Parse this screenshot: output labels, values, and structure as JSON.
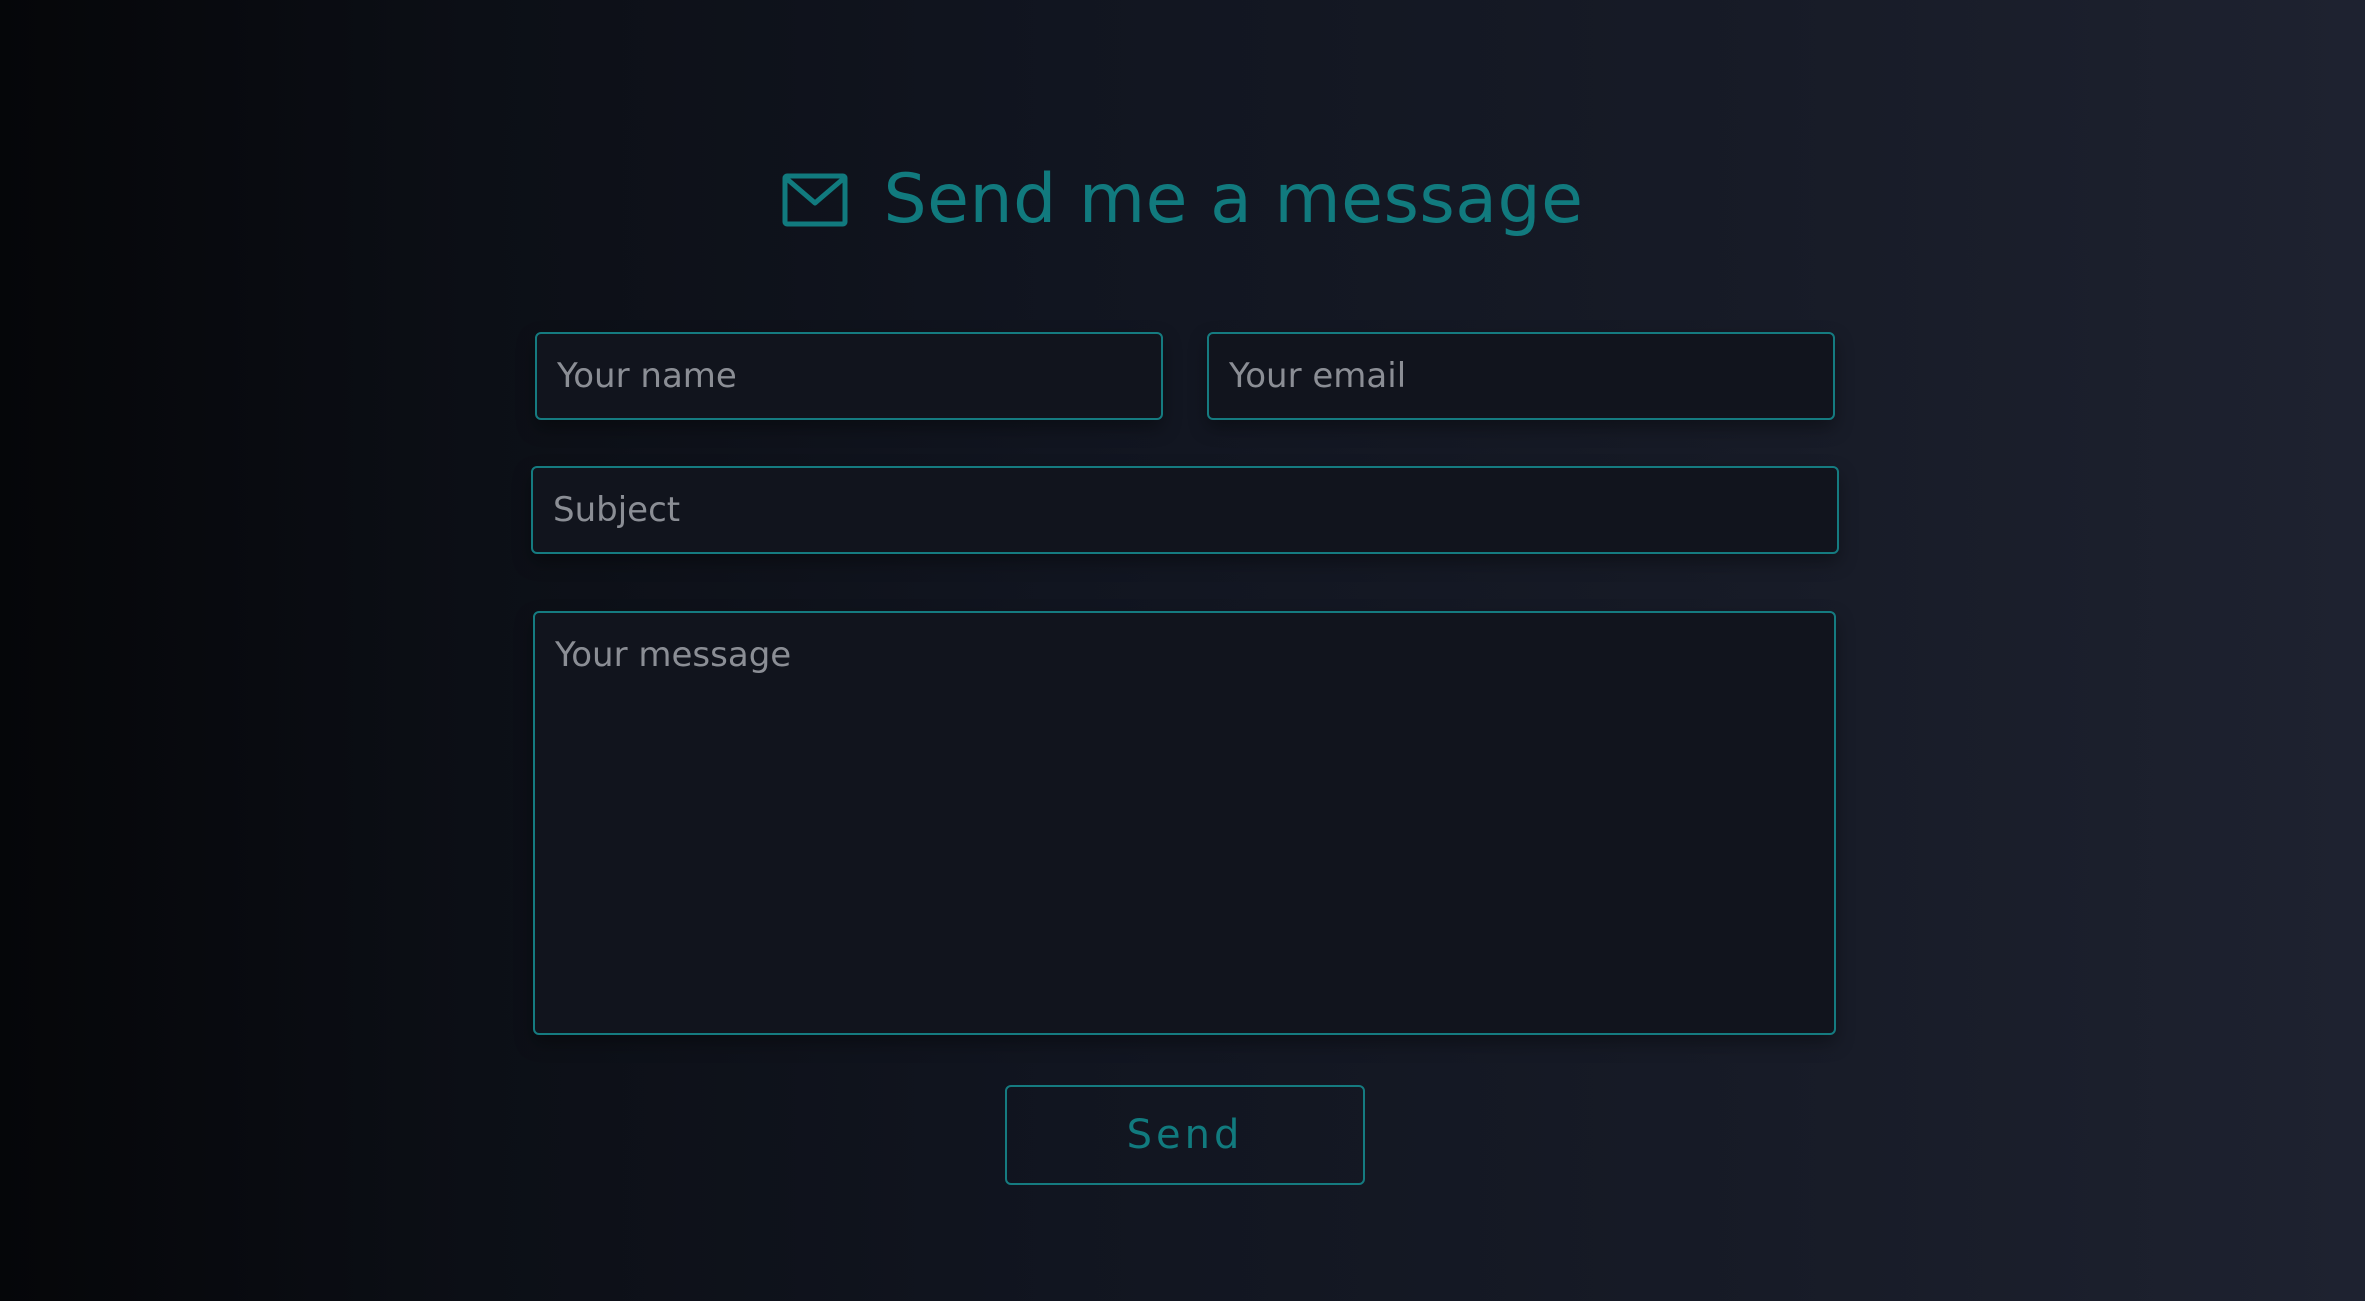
{
  "heading": {
    "icon": "mail-icon",
    "title": "Send me a message"
  },
  "form": {
    "name": {
      "value": "",
      "placeholder": "Your name"
    },
    "email": {
      "value": "",
      "placeholder": "Your email"
    },
    "subject": {
      "value": "",
      "placeholder": "Subject"
    },
    "message": {
      "value": "",
      "placeholder": "Your message"
    },
    "submit_label": "Send"
  },
  "colors": {
    "accent": "#117a7e",
    "border": "#157b80",
    "placeholder": "#8b8e95",
    "field_background": "#11141d",
    "background_left": "#050609",
    "background_right": "#1e2230"
  }
}
